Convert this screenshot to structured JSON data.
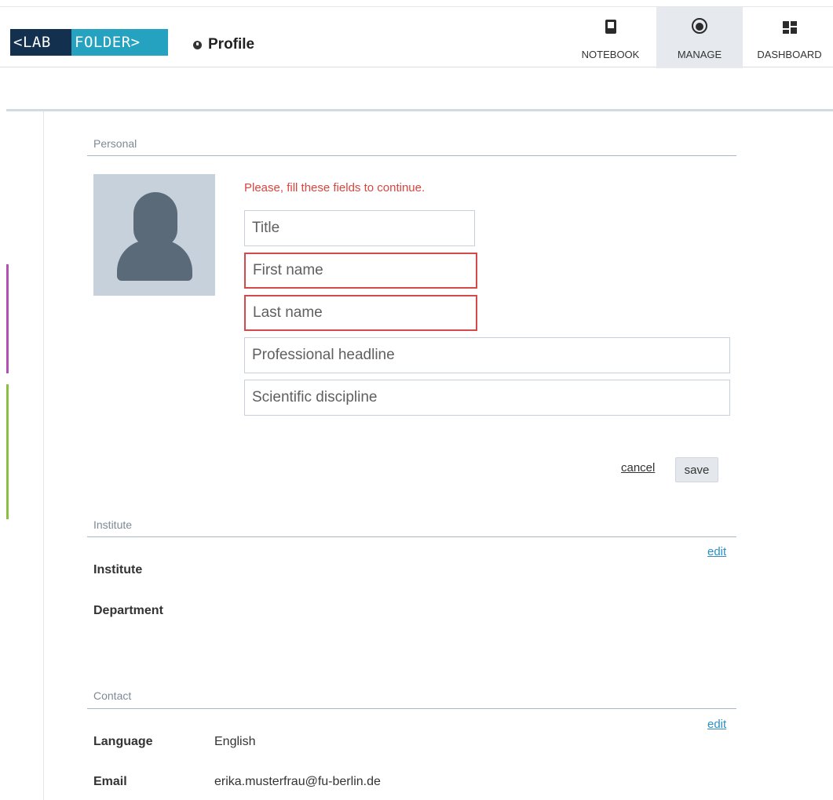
{
  "header": {
    "logo_left": "<LAB",
    "logo_right": "FOLDER>",
    "page_title": "Profile",
    "nav": [
      {
        "label": "NOTEBOOK",
        "icon": "notebook-icon"
      },
      {
        "label": "MANAGE",
        "icon": "manage-icon",
        "active": true
      },
      {
        "label": "DASHBOARD",
        "icon": "dashboard-icon"
      }
    ]
  },
  "personal": {
    "section_label": "Personal",
    "warning": "Please, fill these fields to continue.",
    "fields": {
      "title": {
        "placeholder": "Title",
        "value": ""
      },
      "first_name": {
        "placeholder": "First name",
        "value": ""
      },
      "last_name": {
        "placeholder": "Last name",
        "value": ""
      },
      "headline": {
        "placeholder": "Professional headline",
        "value": ""
      },
      "discipline": {
        "placeholder": "Scientific discipline",
        "value": ""
      }
    },
    "cancel_label": "cancel",
    "save_label": "save"
  },
  "institute": {
    "section_label": "Institute",
    "edit_label": "edit",
    "institute_label": "Institute",
    "department_label": "Department"
  },
  "contact": {
    "section_label": "Contact",
    "edit_label": "edit",
    "language_label": "Language",
    "language_value": "English",
    "email_label": "Email",
    "email_value": "erika.musterfrau@fu-berlin.de"
  },
  "colors": {
    "logo_dark": "#13304f",
    "logo_teal": "#24a2bf",
    "error": "#d9463f",
    "link": "#2d8ec7",
    "accent_purple": "#b44fb6",
    "accent_green": "#8bbf3f"
  }
}
